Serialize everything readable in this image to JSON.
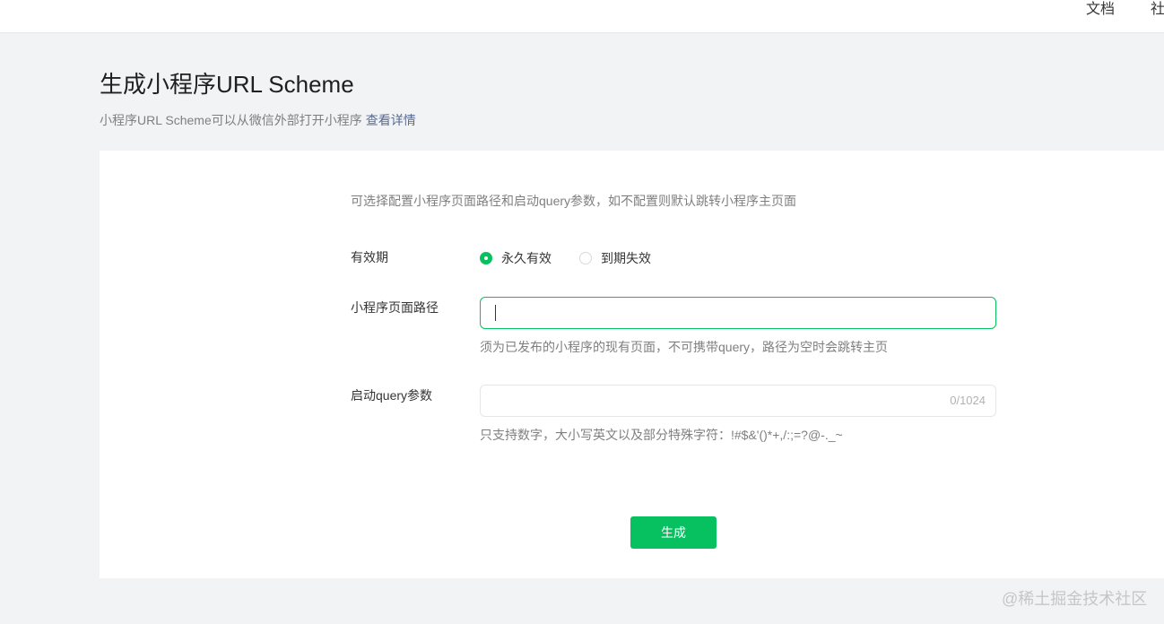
{
  "topbar": {
    "nav_docs": "文档",
    "nav_community": "社"
  },
  "header": {
    "title": "生成小程序URL Scheme",
    "description": "小程序URL Scheme可以从微信外部打开小程序",
    "details_link": "查看详情"
  },
  "form": {
    "hint": "可选择配置小程序页面路径和启动query参数，如不配置则默认跳转小程序主页面",
    "validity": {
      "label": "有效期",
      "options": [
        {
          "label": "永久有效",
          "selected": true
        },
        {
          "label": "到期失效",
          "selected": false
        }
      ]
    },
    "page_path": {
      "label": "小程序页面路径",
      "value": "",
      "help": "须为已发布的小程序的现有页面，不可携带query，路径为空时会跳转主页"
    },
    "query": {
      "label": "启动query参数",
      "value": "",
      "counter": "0/1024",
      "help": "只支持数字，大小写英文以及部分特殊字符：!#$&'()*+,/:;=?@-._~"
    },
    "submit_label": "生成"
  },
  "watermark": "@稀土掘金技术社区",
  "colors": {
    "accent": "#07c160",
    "link": "#576b95",
    "page_bg": "#f2f3f5"
  }
}
